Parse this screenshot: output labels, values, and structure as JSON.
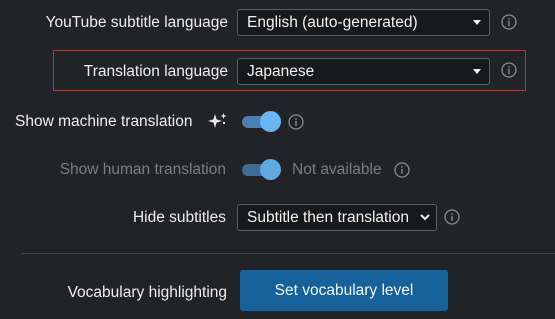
{
  "settings": {
    "youtube_subtitle_language": {
      "label": "YouTube subtitle language",
      "value": "English (auto-generated)"
    },
    "translation_language": {
      "label": "Translation language",
      "value": "Japanese"
    },
    "show_machine_translation": {
      "label": "Show machine translation",
      "icon": "sparkle-icon",
      "enabled": true
    },
    "show_human_translation": {
      "label": "Show human translation",
      "enabled": true,
      "disabled": true,
      "status": "Not available"
    },
    "hide_subtitles": {
      "label": "Hide subtitles",
      "value": "Subtitle then translation"
    },
    "vocabulary_highlighting": {
      "label": "Vocabulary highlighting",
      "button_label": "Set vocabulary level"
    }
  },
  "colors": {
    "background": "#222326",
    "highlight_border": "#cc2b2b",
    "toggle_knob": "#69b7f2",
    "button": "#17619b"
  }
}
